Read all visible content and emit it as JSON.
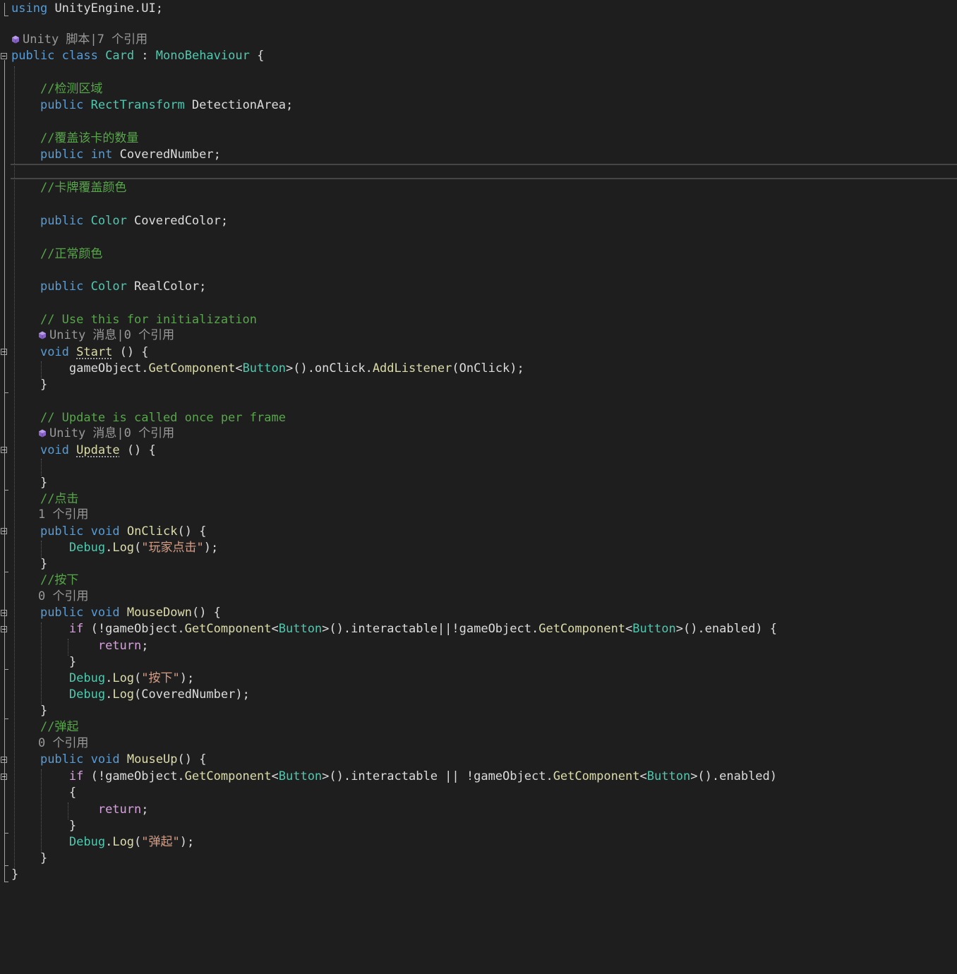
{
  "editor": {
    "colors": {
      "background": "#1e1e1e",
      "keyword": "#569cd6",
      "type": "#4ec9b0",
      "method": "#dcdcaa",
      "comment": "#57a64a",
      "string": "#d69d85",
      "control": "#d8a0df",
      "plain": "#dcdcdc"
    },
    "code": {
      "using": "using",
      "using_target": "UnityEngine.UI;",
      "lens_class": "Unity 脚本|7 个引用",
      "cls_public": "public",
      "cls_class": "class",
      "cls_name": "Card",
      "cls_colon": " : ",
      "cls_base": "MonoBehaviour",
      "cls_brace": " {",
      "c_detect": "//检测区域",
      "f1_public": "public",
      "f1_type": "RectTransform",
      "f1_name": " DetectionArea;",
      "c_covered_num": "//覆盖该卡的数量",
      "f2_public": "public",
      "f2_type": "int",
      "f2_name": " CoveredNumber;",
      "c_covered_color": "//卡牌覆盖颜色",
      "f3_public": "public",
      "f3_type": "Color",
      "f3_name": " CoveredColor;",
      "c_normal_color": "//正常颜色",
      "f4_public": "public",
      "f4_type": "Color",
      "f4_name": " RealColor;",
      "c_init": "// Use this for initialization",
      "lens_start": "Unity 消息|0 个引用",
      "start_void": "void",
      "start_name": "Start",
      "start_rest": " () {",
      "start_body_a": "gameObject.",
      "start_body_fn": "GetComponent",
      "start_body_lt": "<",
      "start_body_ty": "Button",
      "start_body_gt": ">().onClick.",
      "start_body_fn2": "AddListener",
      "start_body_end": "(OnClick);",
      "close_brace": "}",
      "c_update": "// Update is called once per frame",
      "lens_update": "Unity 消息|0 个引用",
      "update_void": "void",
      "update_name": "Update",
      "update_rest": " () {",
      "c_click": "//点击",
      "lens_onclick": "1 个引用",
      "oc_public": "public",
      "oc_void": "void",
      "oc_name": "OnClick",
      "oc_rest": "() {",
      "oc_debug": "Debug",
      "oc_dot": ".",
      "oc_log": "Log",
      "oc_open": "(",
      "oc_str": "\"玩家点击\"",
      "oc_close": ");",
      "c_press": "//按下",
      "lens_mousedown": "0 个引用",
      "md_public": "public",
      "md_void": "void",
      "md_name": "MouseDown",
      "md_rest": "() {",
      "md_if": "if",
      "md_if_a": " (!gameObject.",
      "md_if_fn1": "GetComponent",
      "md_if_lt1": "<",
      "md_if_ty1": "Button",
      "md_if_b": ">().interactable||!gameObject.",
      "md_if_fn2": "GetComponent",
      "md_if_lt2": "<",
      "md_if_ty2": "Button",
      "md_if_c": ">().enabled) {",
      "md_return": "return",
      "md_semi": ";",
      "md_log1_debug": "Debug",
      "md_log1_dot": ".",
      "md_log1_log": "Log",
      "md_log1_open": "(",
      "md_log1_str": "\"按下\"",
      "md_log1_close": ");",
      "md_log2_debug": "Debug",
      "md_log2_dot": ".",
      "md_log2_log": "Log",
      "md_log2_rest": "(CoveredNumber);",
      "c_popup": "//弹起",
      "lens_mouseup": "0 个引用",
      "mu_public": "public",
      "mu_void": "void",
      "mu_name": "MouseUp",
      "mu_rest": "() {",
      "mu_if": "if",
      "mu_if_a": " (!gameObject.",
      "mu_if_fn1": "GetComponent",
      "mu_if_lt1": "<",
      "mu_if_ty1": "Button",
      "mu_if_b": ">().interactable || !gameObject.",
      "mu_if_fn2": "GetComponent",
      "mu_if_lt2": "<",
      "mu_if_ty2": "Button",
      "mu_if_c": ">().enabled)",
      "open_brace": "{",
      "mu_return": "return",
      "mu_semi": ";",
      "mu_log_debug": "Debug",
      "mu_log_dot": ".",
      "mu_log_log": "Log",
      "mu_log_open": "(",
      "mu_log_str": "\"弹起\"",
      "mu_log_close": ");"
    }
  }
}
